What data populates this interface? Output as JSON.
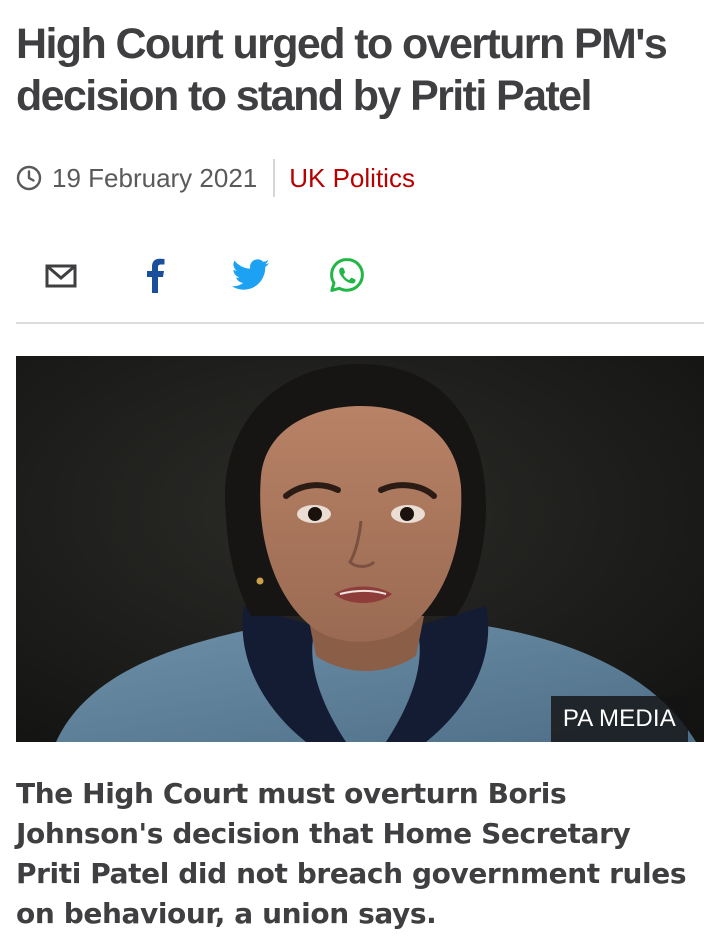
{
  "article": {
    "headline": "High Court urged to overturn PM's decision to stand by Priti Patel",
    "date": "19 February 2021",
    "topic": "UK Politics",
    "image_credit": "PA MEDIA",
    "intro": "The High Court must overturn Boris Johnson's decision that Home Secretary Priti Patel did not breach government rules on behaviour, a union says."
  },
  "share": {
    "icons": [
      "email-icon",
      "facebook-icon",
      "twitter-icon",
      "whatsapp-icon"
    ]
  },
  "colors": {
    "text": "#3f3f42",
    "topic_link": "#b80000",
    "facebook": "#1b4f9c",
    "twitter": "#1da1f2",
    "whatsapp": "#21b646"
  }
}
